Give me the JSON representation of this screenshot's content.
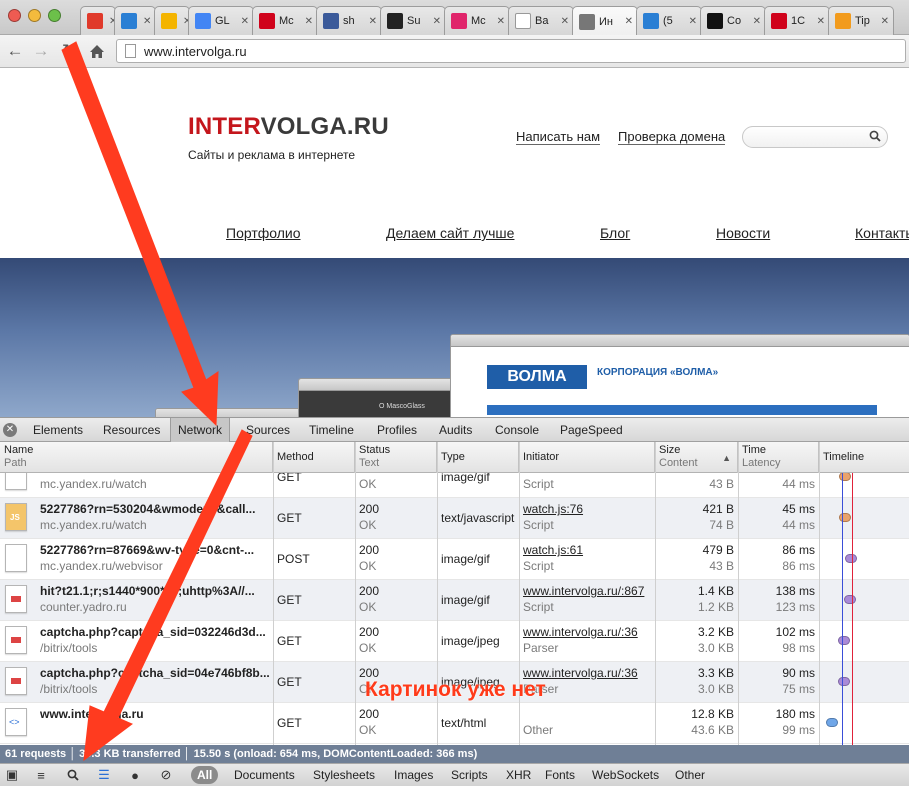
{
  "tabs": [
    {
      "title": "",
      "icon": "formula-icon",
      "color": "#e03a2b"
    },
    {
      "title": "",
      "icon": "24-icon",
      "color": "#2a7fd4"
    },
    {
      "title": "",
      "icon": "google-drive-icon",
      "color": "#f4b400"
    },
    {
      "title": "GL",
      "icon": "document-icon",
      "color": "#4285f4"
    },
    {
      "title": "Mc",
      "icon": "mail-icon",
      "color": "#d0021b"
    },
    {
      "title": "sh",
      "icon": "shield-icon",
      "color": "#3b5a9a"
    },
    {
      "title": "Su",
      "icon": "e-icon",
      "color": "#222222"
    },
    {
      "title": "Mc",
      "icon": "chart-icon",
      "color": "#e0256b"
    },
    {
      "title": "Ba",
      "icon": "page-icon",
      "color": "#ffffff"
    },
    {
      "title": "Ин",
      "icon": "globe-icon",
      "color": "#777777"
    },
    {
      "title": "(5",
      "icon": "24-icon",
      "color": "#2a7fd4"
    },
    {
      "title": "Co",
      "icon": "phone-icon",
      "color": "#111111"
    },
    {
      "title": "1С",
      "icon": "mail-icon",
      "color": "#d0021b"
    },
    {
      "title": "Tip",
      "icon": "heart-icon",
      "color": "#f29b1d"
    }
  ],
  "address": "www.intervolga.ru",
  "site": {
    "logo_red": "INTER",
    "logo_dark": "VOLGA.RU",
    "tagline": "Сайты и реклама в интернете",
    "top_links": [
      "Написать нам",
      "Проверка домена"
    ],
    "menu": [
      "Портфолио",
      "Делаем сайт лучше",
      "Блог",
      "Новости",
      "Контакты"
    ],
    "hero_brand": "ВОЛМА",
    "hero_title": "КОРПОРАЦИЯ «ВОЛМА»",
    "hero_caption": "O MascoGlass"
  },
  "devtools": {
    "tabs": [
      "Elements",
      "Resources",
      "Network",
      "Sources",
      "Timeline",
      "Profiles",
      "Audits",
      "Console",
      "PageSpeed"
    ],
    "active_tab": "Network",
    "columns": {
      "name": "Name",
      "path": "Path",
      "method": "Method",
      "status": "Status",
      "status_text": "Text",
      "type": "Type",
      "initiator": "Initiator",
      "size": "Size",
      "content": "Content",
      "time": "Time",
      "latency": "Latency",
      "timeline": "Timeline"
    },
    "rows": [
      {
        "name": "",
        "path": "mc.yandex.ru/watch",
        "method": "GET",
        "status": "",
        "status_text": "OK",
        "type": "image/gif",
        "initiator": "",
        "initiator_sub": "Script",
        "size": "",
        "content": "43 B",
        "time": "",
        "latency": "44 ms",
        "icon": "blank"
      },
      {
        "name": "5227786?rn=530204&wmode=5&call...",
        "path": "mc.yandex.ru/watch",
        "method": "GET",
        "status": "200",
        "status_text": "OK",
        "type": "text/javascript",
        "initiator": "watch.js:76",
        "initiator_sub": "Script",
        "size": "421 B",
        "content": "74 B",
        "time": "45 ms",
        "latency": "44 ms",
        "icon": "js"
      },
      {
        "name": "5227786?rn=87669&wv-type=0&cnt-...",
        "path": "mc.yandex.ru/webvisor",
        "method": "POST",
        "status": "200",
        "status_text": "OK",
        "type": "image/gif",
        "initiator": "watch.js:61",
        "initiator_sub": "Script",
        "size": "479 B",
        "content": "43 B",
        "time": "86 ms",
        "latency": "86 ms",
        "icon": "blank"
      },
      {
        "name": "hit?t21.1;r;s1440*900*24;uhttp%3A//...",
        "path": "counter.yadro.ru",
        "method": "GET",
        "status": "200",
        "status_text": "OK",
        "type": "image/gif",
        "initiator": "www.intervolga.ru/:867",
        "initiator_sub": "Script",
        "size": "1.4 KB",
        "content": "1.2 KB",
        "time": "138 ms",
        "latency": "123 ms",
        "icon": "img"
      },
      {
        "name": "captcha.php?captcha_sid=032246d3d...",
        "path": "/bitrix/tools",
        "method": "GET",
        "status": "200",
        "status_text": "OK",
        "type": "image/jpeg",
        "initiator": "www.intervolga.ru/:36",
        "initiator_sub": "Parser",
        "size": "3.2 KB",
        "content": "3.0 KB",
        "time": "102 ms",
        "latency": "98 ms",
        "icon": "img"
      },
      {
        "name": "captcha.php?captcha_sid=04e746bf8b...",
        "path": "/bitrix/tools",
        "method": "GET",
        "status": "200",
        "status_text": "OK",
        "type": "image/jpeg",
        "initiator": "www.intervolga.ru/:36",
        "initiator_sub": "Parser",
        "size": "3.3 KB",
        "content": "3.0 KB",
        "time": "90 ms",
        "latency": "75 ms",
        "icon": "img"
      },
      {
        "name": "www.intervolga.ru",
        "path": "",
        "method": "GET",
        "status": "200",
        "status_text": "OK",
        "type": "text/html",
        "initiator": "",
        "initiator_sub": "Other",
        "size": "12.8 KB",
        "content": "43.6 KB",
        "time": "180 ms",
        "latency": "99 ms",
        "icon": "html"
      }
    ],
    "summary": "61 requests  │  35.3 KB transferred  │  15.50 s (onload: 654 ms, DOMContentLoaded: 366 ms)",
    "filters": [
      "All",
      "Documents",
      "Stylesheets",
      "Images",
      "Scripts",
      "XHR",
      "Fonts",
      "WebSockets",
      "Other"
    ]
  },
  "annotation": "Картинок уже нет"
}
